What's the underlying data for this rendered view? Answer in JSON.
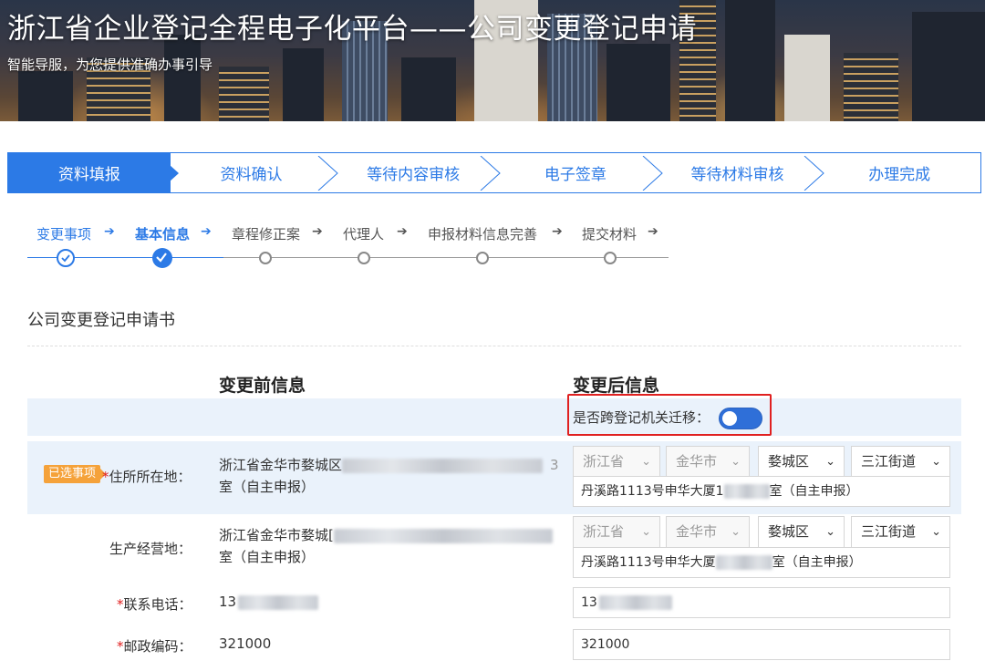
{
  "header": {
    "title": "浙江省企业登记全程电子化平台——公司变更登记申请",
    "subtitle": "智能导服，为您提供准确办事引导"
  },
  "process_steps": [
    {
      "label": "资料填报",
      "active": true
    },
    {
      "label": "资料确认",
      "active": false
    },
    {
      "label": "等待内容审核",
      "active": false
    },
    {
      "label": "电子签章",
      "active": false
    },
    {
      "label": "等待材料审核",
      "active": false
    },
    {
      "label": "办理完成",
      "active": false
    }
  ],
  "sub_steps": [
    {
      "label": "变更事项",
      "status": "done"
    },
    {
      "label": "基本信息",
      "status": "current"
    },
    {
      "label": "章程修正案",
      "status": "todo"
    },
    {
      "label": "代理人",
      "status": "todo"
    },
    {
      "label": "申报材料信息完善",
      "status": "todo"
    },
    {
      "label": "提交材料",
      "status": "todo"
    }
  ],
  "sub_step_arrow": "➔",
  "form": {
    "title": "公司变更登记申请书",
    "before_header": "变更前信息",
    "after_header": "变更后信息",
    "cross_migration_label": "是否跨登记机关迁移：",
    "cross_migration_on": true,
    "selected_badge": "已选事项",
    "required_mark": "*",
    "rows": {
      "residence": {
        "label": "住所所在地：",
        "before_line1_prefix": "浙江省金华市婺城区",
        "before_line1_suffix": "3",
        "before_line2": "室（自主申报）",
        "province": "浙江省",
        "city": "金华市",
        "district": "婺城区",
        "street": "三江街道",
        "detail_prefix": "丹溪路1113号申华大厦1",
        "detail_suffix": "室（自主申报）"
      },
      "business": {
        "label": "生产经营地：",
        "before_line1_prefix": "浙江省金华市婺城[",
        "before_line2": "室（自主申报）",
        "province": "浙江省",
        "city": "金华市",
        "district": "婺城区",
        "street": "三江街道",
        "detail_prefix": "丹溪路1113号申华大厦",
        "detail_suffix": "室（自主申报）"
      },
      "phone": {
        "label": "联系电话：",
        "before_prefix": "13",
        "after_prefix": "13"
      },
      "postcode": {
        "label": "邮政编码：",
        "before": "321000",
        "after": "321000"
      }
    }
  },
  "icons": {
    "chevron": "chevron-down-icon",
    "check": "check-icon"
  },
  "colors": {
    "accent": "#2c7ae6",
    "highlight_border": "#e02020",
    "badge": "#f5a23a",
    "row_bg": "#eaf2fb"
  }
}
